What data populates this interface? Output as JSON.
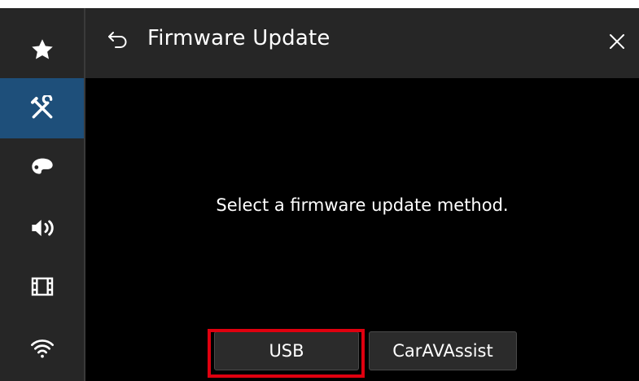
{
  "header": {
    "title": "Firmware Update",
    "back_icon": "back-arrow-icon",
    "close_icon": "close-icon"
  },
  "sidebar": {
    "items": [
      {
        "icon": "star-icon",
        "active": false
      },
      {
        "icon": "tools-icon",
        "active": true
      },
      {
        "icon": "palette-icon",
        "active": false
      },
      {
        "icon": "speaker-icon",
        "active": false
      },
      {
        "icon": "film-icon",
        "active": false
      },
      {
        "icon": "wifi-icon",
        "active": false
      }
    ]
  },
  "main": {
    "message": "Select a firmware update method.",
    "buttons": [
      {
        "label": "USB",
        "highlighted": true
      },
      {
        "label": "CarAVAssist",
        "highlighted": false
      }
    ]
  },
  "colors": {
    "background": "#000000",
    "panel": "#262626",
    "active": "#1e4f7a",
    "highlight": "#e0000f"
  }
}
